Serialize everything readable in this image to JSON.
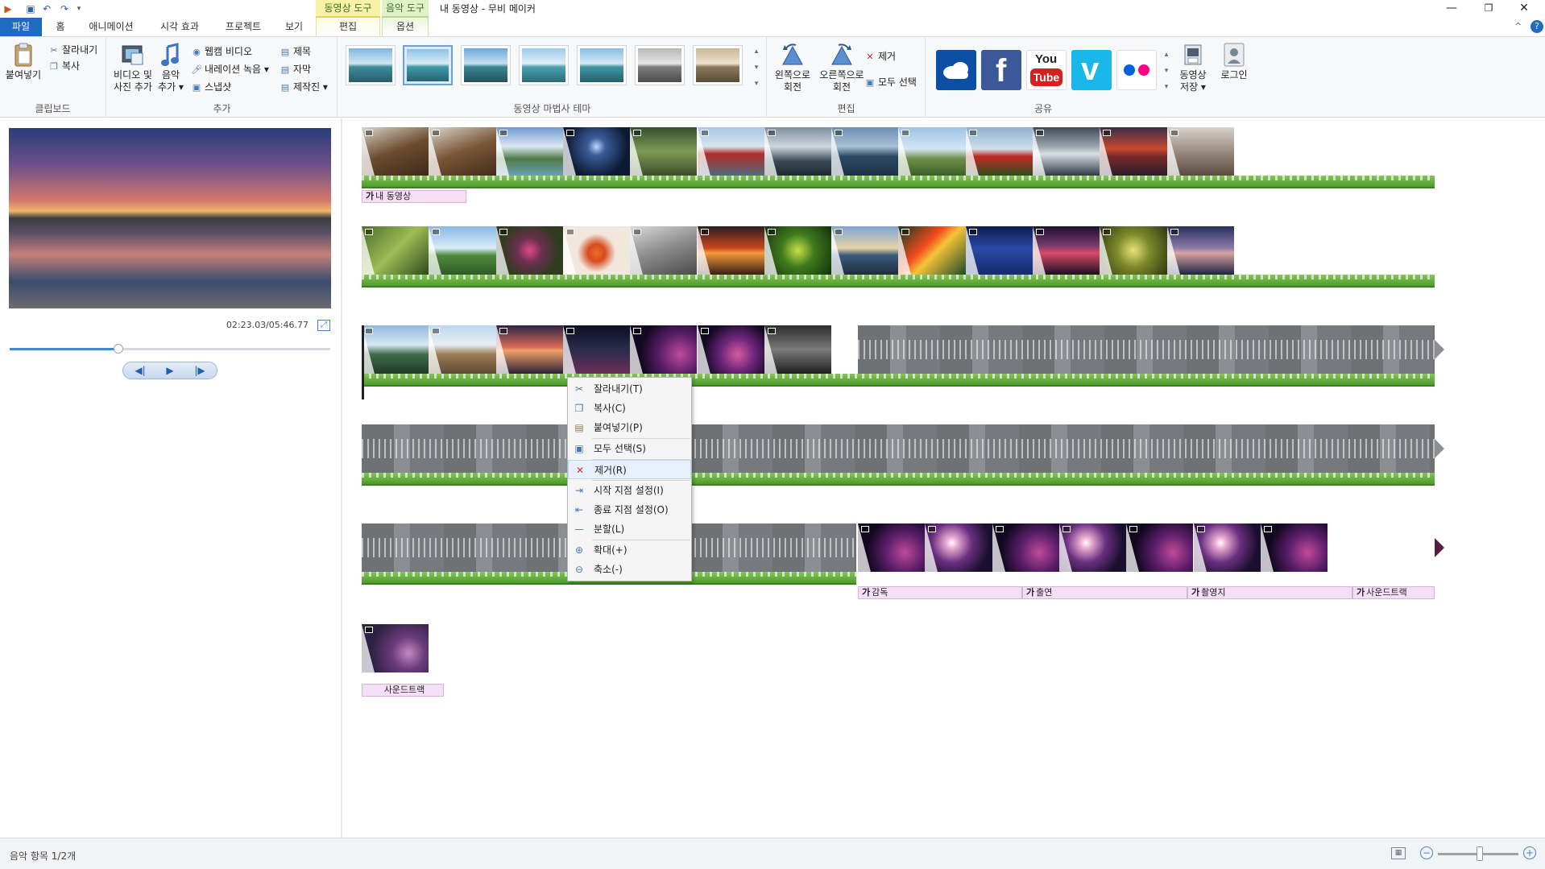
{
  "titlebar": {
    "context_tab_video": "동영상 도구",
    "context_tab_music": "음악 도구",
    "window_title": "내 동영상 - 무비 메이커",
    "minimize": "—",
    "restore": "❐",
    "close": "✕"
  },
  "tabs": {
    "file": "파일",
    "home": "홈",
    "animation": "애니메이션",
    "visual_effects": "시각 효과",
    "project": "프로젝트",
    "view": "보기",
    "edit": "편집",
    "options": "옵션"
  },
  "ribbon": {
    "clipboard": {
      "paste": "붙여넣기",
      "cut": "잘라내기",
      "copy": "복사",
      "group_label": "클립보드"
    },
    "add": {
      "add_video_photo_l1": "비디오 및",
      "add_video_photo_l2": "사진 추가",
      "add_music_l1": "음악",
      "add_music_l2": "추가 ▾",
      "webcam_video": "웹캠 비디오",
      "record_narration": "내레이션 녹음 ▾",
      "snapshot": "스냅샷",
      "title": "제목",
      "caption": "자막",
      "credits": "제작진 ▾",
      "group_label": "추가"
    },
    "themes": {
      "group_label": "동영상 마법사 테마",
      "selected_index": 1
    },
    "edit": {
      "rotate_left_l1": "왼쪽으로",
      "rotate_left_l2": "회전",
      "rotate_right_l1": "오른쪽으로",
      "rotate_right_l2": "회전",
      "remove": "제거",
      "select_all": "모두 선택",
      "group_label": "편집"
    },
    "share": {
      "group_label": "공유",
      "save_movie_l1": "동영상",
      "save_movie_l2": "저장 ▾",
      "sign_in": "로그인",
      "youtube_l1": "You",
      "youtube_l2": "Tube"
    }
  },
  "preview": {
    "timecode": "02:23.03/05:46.77",
    "seek_progress": 0.34
  },
  "timeline": {
    "caption_row1": "내 동영상",
    "caption_row5": [
      "감독",
      "출연",
      "촬영지",
      "사운드트랙"
    ],
    "caption_row6": "사운드트랙"
  },
  "context_menu": {
    "items": [
      {
        "label": "잘라내기(T)",
        "icon": "scissors-icon"
      },
      {
        "label": "복사(C)",
        "icon": "copy-icon"
      },
      {
        "label": "붙여넣기(P)",
        "icon": "paste-icon"
      },
      {
        "label": "모두 선택(S)",
        "icon": "select-all-icon"
      },
      {
        "label": "제거(R)",
        "icon": "remove-icon"
      },
      {
        "label": "시작 지점 설정(I)",
        "icon": "set-start-icon"
      },
      {
        "label": "종료 지점 설정(O)",
        "icon": "set-end-icon"
      },
      {
        "label": "분할(L)",
        "icon": "split-icon"
      },
      {
        "label": "확대(+)",
        "icon": "zoom-in-icon"
      },
      {
        "label": "축소(-)",
        "icon": "zoom-out-icon"
      }
    ],
    "hover_index": 4
  },
  "statusbar": {
    "text": "음악 항목 1/2개",
    "zoom_level": 0.45
  },
  "colors": {
    "accent": "#1f6bc1",
    "audio_green": "#4f9b2c",
    "caption_pink": "#f4dff7"
  }
}
